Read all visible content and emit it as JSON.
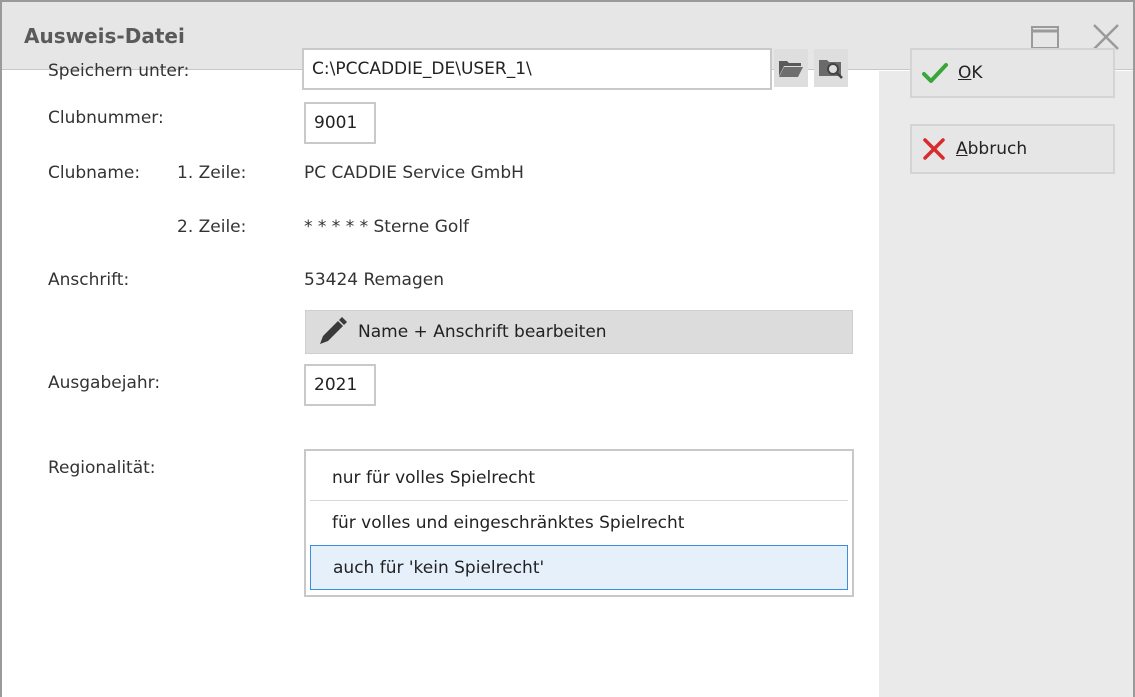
{
  "window": {
    "title": "Ausweis-Datei"
  },
  "form": {
    "save_label": "Speichern unter:",
    "save_path": "C:\\PCCADDIE_DE\\USER_1\\",
    "clubnumber_label": "Clubnummer:",
    "clubnumber_value": "9001",
    "clubname_label": "Clubname:",
    "line1_label": "1. Zeile:",
    "line1_value": "PC CADDIE Service GmbH",
    "line2_label": "2. Zeile:",
    "line2_value": "* * * * * Sterne Golf",
    "address_label": "Anschrift:",
    "address_value": "53424 Remagen",
    "edit_button_label": "Name + Anschrift bearbeiten",
    "year_label": "Ausgabejahr:",
    "year_value": "2021",
    "region_label": "Regionalität:",
    "region_options": [
      "nur für volles Spielrecht",
      "für volles und eingeschränktes Spielrecht",
      "auch für 'kein Spielrecht'"
    ],
    "region_selected": "auch für 'kein Spielrecht'"
  },
  "side": {
    "ok_first": "O",
    "ok_rest": "K",
    "cancel_first": "A",
    "cancel_rest": "bbruch"
  },
  "colors": {
    "ok_green": "#3aa63a",
    "cancel_red": "#d82c2c",
    "selection_border": "#3c8de0"
  },
  "icons": [
    "maximize-icon",
    "close-icon",
    "folder-open-icon",
    "folder-search-icon",
    "pencil-icon",
    "check-icon",
    "cross-icon"
  ]
}
